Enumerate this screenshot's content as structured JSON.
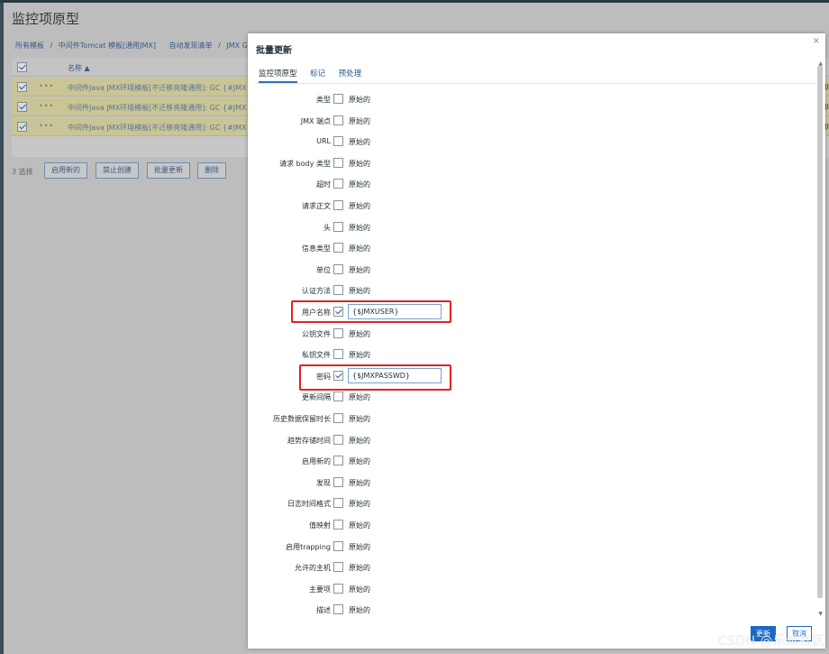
{
  "page": {
    "title": "监控项原型",
    "breadcrumb": [
      "所有模板",
      "/",
      "中间件Tomcat 模板[通用JMX]",
      "自动发现清单",
      "/",
      "JMX Gc"
    ],
    "table": {
      "col_name": "名称 ▲",
      "rows": [
        {
          "dots": "•••",
          "name": "中间件Java JMX环境模板[不迁移亮隆通用]: GC {#JMX",
          "right": "JI"
        },
        {
          "dots": "•••",
          "name": "中间件Java JMX环境模板[不迁移亮隆通用]: GC {#JMX",
          "right": "JI"
        },
        {
          "dots": "•••",
          "name": "中间件Java JMX环境模板[不迁移亮隆通用]: GC {#JMX",
          "right": "JI"
        }
      ]
    },
    "actions": {
      "selected": "3 选择",
      "enable": "启用新的",
      "disable": "禁止创建",
      "mass_update": "批量更新",
      "delete": "删除"
    }
  },
  "modal": {
    "title": "批量更新",
    "close": "×",
    "tabs": [
      "监控项原型",
      "标记",
      "预处理"
    ],
    "original_label": "原始的",
    "fields": [
      {
        "label": "类型",
        "checked": false
      },
      {
        "label": "JMX 端点",
        "checked": false
      },
      {
        "label": "URL",
        "checked": false
      },
      {
        "label": "请求 body 类型",
        "checked": false
      },
      {
        "label": "超时",
        "checked": false
      },
      {
        "label": "请求正文",
        "checked": false
      },
      {
        "label": "头",
        "checked": false
      },
      {
        "label": "信息类型",
        "checked": false
      },
      {
        "label": "单位",
        "checked": false
      },
      {
        "label": "认证方法",
        "checked": false
      },
      {
        "label": "用户名称",
        "checked": true,
        "value": "{$JMXUSER}"
      },
      {
        "label": "公钥文件",
        "checked": false
      },
      {
        "label": "私钥文件",
        "checked": false
      },
      {
        "label": "密码",
        "checked": true,
        "value": "{$JMXPASSWD}"
      },
      {
        "label": "更新间隔",
        "checked": false
      },
      {
        "label": "历史数据保留时长",
        "checked": false
      },
      {
        "label": "趋势存储时间",
        "checked": false
      },
      {
        "label": "启用新的",
        "checked": false
      },
      {
        "label": "发现",
        "checked": false
      },
      {
        "label": "日志时间格式",
        "checked": false
      },
      {
        "label": "值映射",
        "checked": false
      },
      {
        "label": "启用trapping",
        "checked": false
      },
      {
        "label": "允许的主机",
        "checked": false
      },
      {
        "label": "主要项",
        "checked": false
      },
      {
        "label": "描述",
        "checked": false
      }
    ],
    "footer": {
      "update": "更新",
      "cancel": "取消"
    }
  },
  "watermark": "CSDN @乐维社区",
  "colors": {
    "highlight": "#e02323",
    "accent": "#1a68c8",
    "selected_row": "#c9c596"
  }
}
